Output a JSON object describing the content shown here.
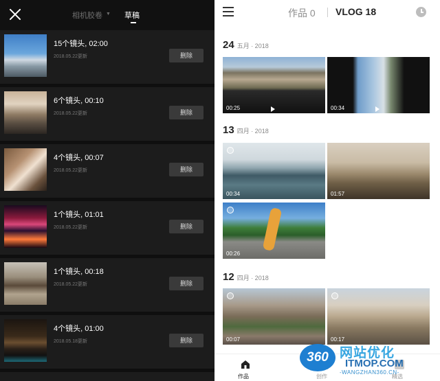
{
  "left_panel": {
    "tabs": {
      "film": "相机胶卷",
      "draft": "草稿"
    },
    "drafts": [
      {
        "title": "15个镜头, 02:00",
        "date": "2018.05.22更新",
        "delete": "删除"
      },
      {
        "title": "6个镜头, 00:10",
        "date": "2018.05.22更新",
        "delete": "删除"
      },
      {
        "title": "4个镜头, 00:07",
        "date": "2018.05.22更新",
        "delete": "删除"
      },
      {
        "title": "1个镜头, 01:01",
        "date": "2018.05.22更新",
        "delete": "删除"
      },
      {
        "title": "1个镜头, 00:18",
        "date": "2018.05.22更新",
        "delete": "删除"
      },
      {
        "title": "4个镜头, 01:00",
        "date": "2018.05.18更新",
        "delete": "删除"
      }
    ]
  },
  "right_panel": {
    "header": {
      "works": "作品 0",
      "vlog": "VLOG 18"
    },
    "groups": [
      {
        "day": "24",
        "sub": "五月 · 2018",
        "clips": [
          {
            "duration": "00:25"
          },
          {
            "duration": "00:34"
          }
        ]
      },
      {
        "day": "13",
        "sub": "四月 · 2018",
        "clips": [
          {
            "duration": "00:34"
          },
          {
            "duration": "01:57"
          },
          {
            "duration": "00:26"
          }
        ]
      },
      {
        "day": "12",
        "sub": "四月 · 2018",
        "clips": [
          {
            "duration": "00:07"
          },
          {
            "duration": "00:17"
          }
        ]
      }
    ],
    "bottom_nav": {
      "works_tab": "作品",
      "tab2": "创作",
      "tab3": "精选"
    }
  },
  "watermark": {
    "badge": "360",
    "cn": "网站优化",
    "site": "ITMOP.COM",
    "url": "-WANGZHAN360.CN-"
  }
}
